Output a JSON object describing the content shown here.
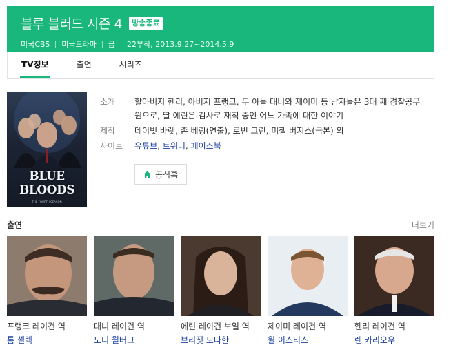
{
  "header": {
    "title": "블루 블러드 시즌 4",
    "badge": "방송종료",
    "meta": [
      "미국CBS",
      "미국드라마",
      "금",
      "22부작, 2013.9.27~2014.5.9"
    ]
  },
  "tabs": [
    {
      "label": "TV정보",
      "active": true
    },
    {
      "label": "출연",
      "active": false
    },
    {
      "label": "시리즈",
      "active": false
    }
  ],
  "poster": {
    "title": "BLUE BLOODS",
    "subtitle": "THE FOURTH SEASON"
  },
  "info": {
    "intro_label": "소개",
    "intro_text": "할아버지 헨리, 아버지 프랭크, 두 아들 대니와 제이미 등 남자들은 3대 째 경찰공무원으로, 딸 에린은 검사로 재직 중인 어느 가족에 대한 이야기",
    "production_label": "제작",
    "production_text": "데이빗 바렛, 존 베링(연출), 로빈 그린, 미첼 버지스(극본) 외",
    "site_label": "사이트",
    "sites": [
      "유튜브",
      "트위터",
      "페이스북"
    ],
    "homepage_button": "공식홈"
  },
  "cast_section": {
    "title": "출연",
    "more": "더보기",
    "members": [
      {
        "role": "프랭크 레이건 역",
        "name": "톰 셀렉"
      },
      {
        "role": "대니 레이건 역",
        "name": "도니 월버그"
      },
      {
        "role": "에린 레이건 보일 역",
        "name": "브리짓 모나한"
      },
      {
        "role": "제이미 레이건 역",
        "name": "윌 이스티스"
      },
      {
        "role": "헨리 레이건 역",
        "name": "렌 카리오우"
      }
    ]
  },
  "colors": {
    "brand_green": "#19b77c",
    "link_blue": "#1a3ea0"
  }
}
